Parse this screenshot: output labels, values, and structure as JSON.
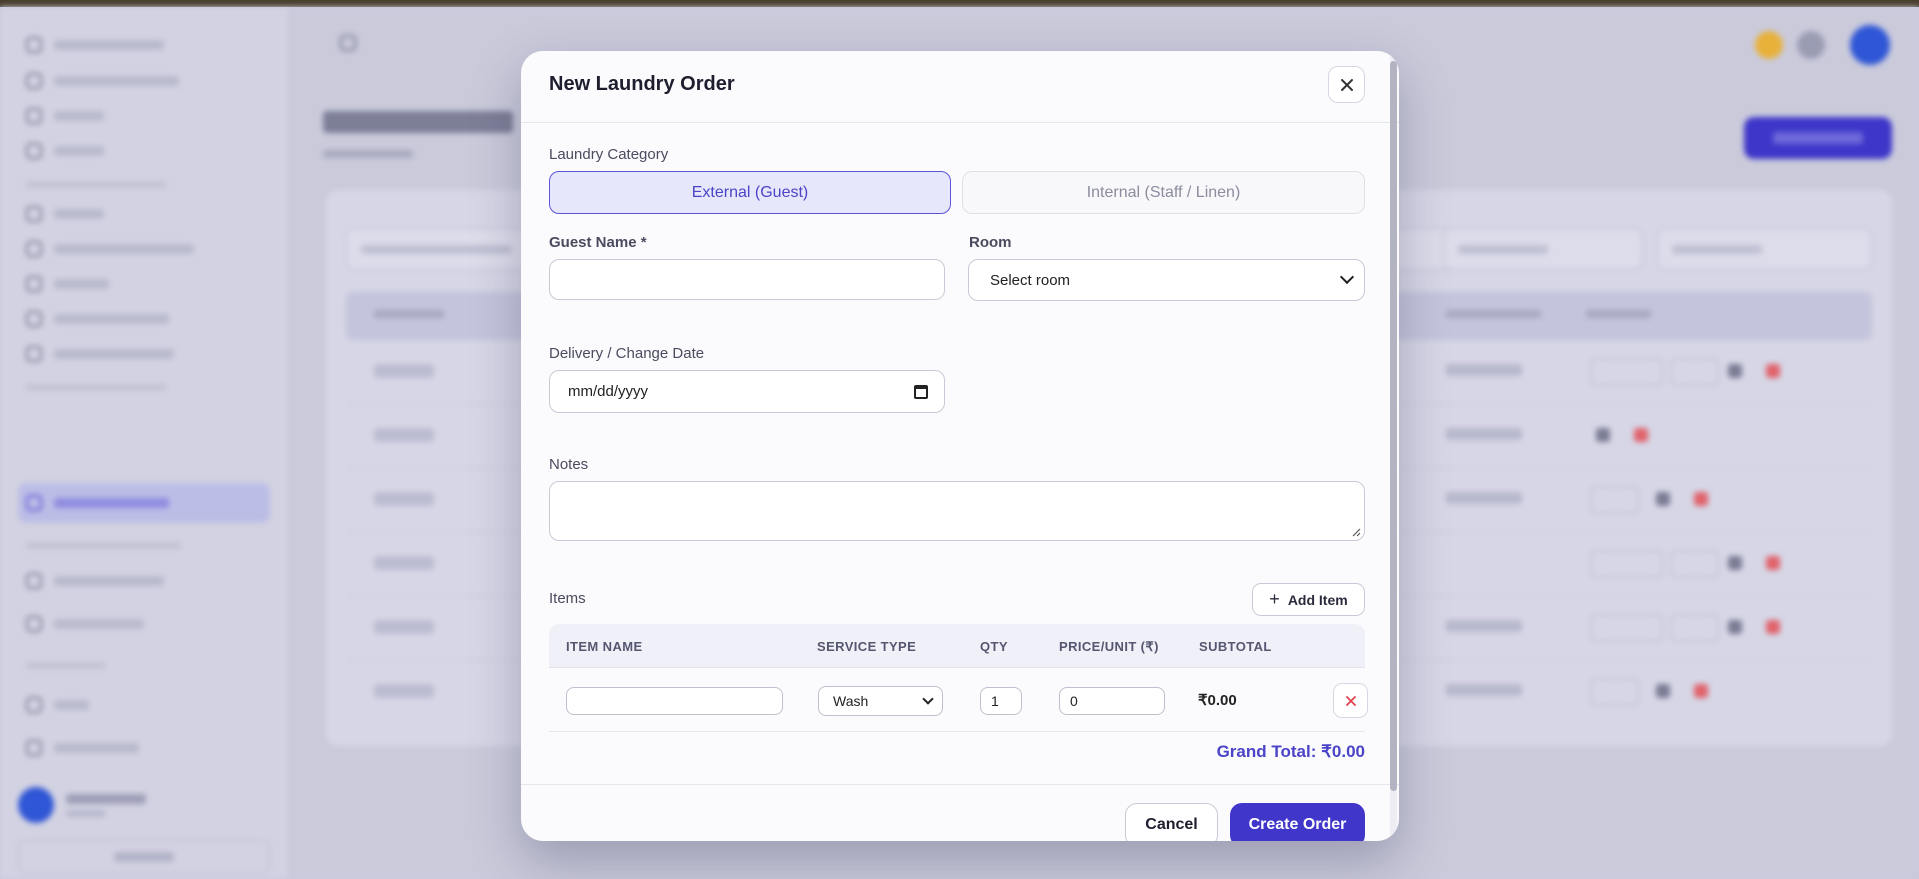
{
  "modal": {
    "title": "New Laundry Order",
    "category_label": "Laundry Category",
    "category_options": [
      "External (Guest)",
      "Internal (Staff / Linen)"
    ],
    "selected_category": "External (Guest)",
    "guest_name_label": "Guest Name *",
    "guest_name_value": "",
    "room_label": "Room",
    "room_value": "Select room",
    "date_label": "Delivery / Change Date",
    "date_placeholder": "mm/dd/yyyy",
    "notes_label": "Notes",
    "notes_value": "",
    "items_label": "Items",
    "add_item_label": "Add Item",
    "items_columns": [
      "ITEM NAME",
      "SERVICE TYPE",
      "QTY",
      "PRICE/UNIT (₹)",
      "SUBTOTAL"
    ],
    "items": [
      {
        "item_name": "",
        "service_type": "Wash",
        "qty": "1",
        "price": "0",
        "subtotal": "₹0.00"
      }
    ],
    "grand_total": "Grand Total: ₹0.00",
    "cancel_label": "Cancel",
    "create_label": "Create Order"
  },
  "colors": {
    "accent": "#4036c9",
    "accent_light": "#e7e7fb",
    "danger": "#e0434b"
  },
  "icons": {
    "close": "close-icon",
    "add": "plus-icon",
    "remove": "close-icon",
    "dropdown": "chevron-down-icon",
    "calendar": "calendar-icon"
  }
}
